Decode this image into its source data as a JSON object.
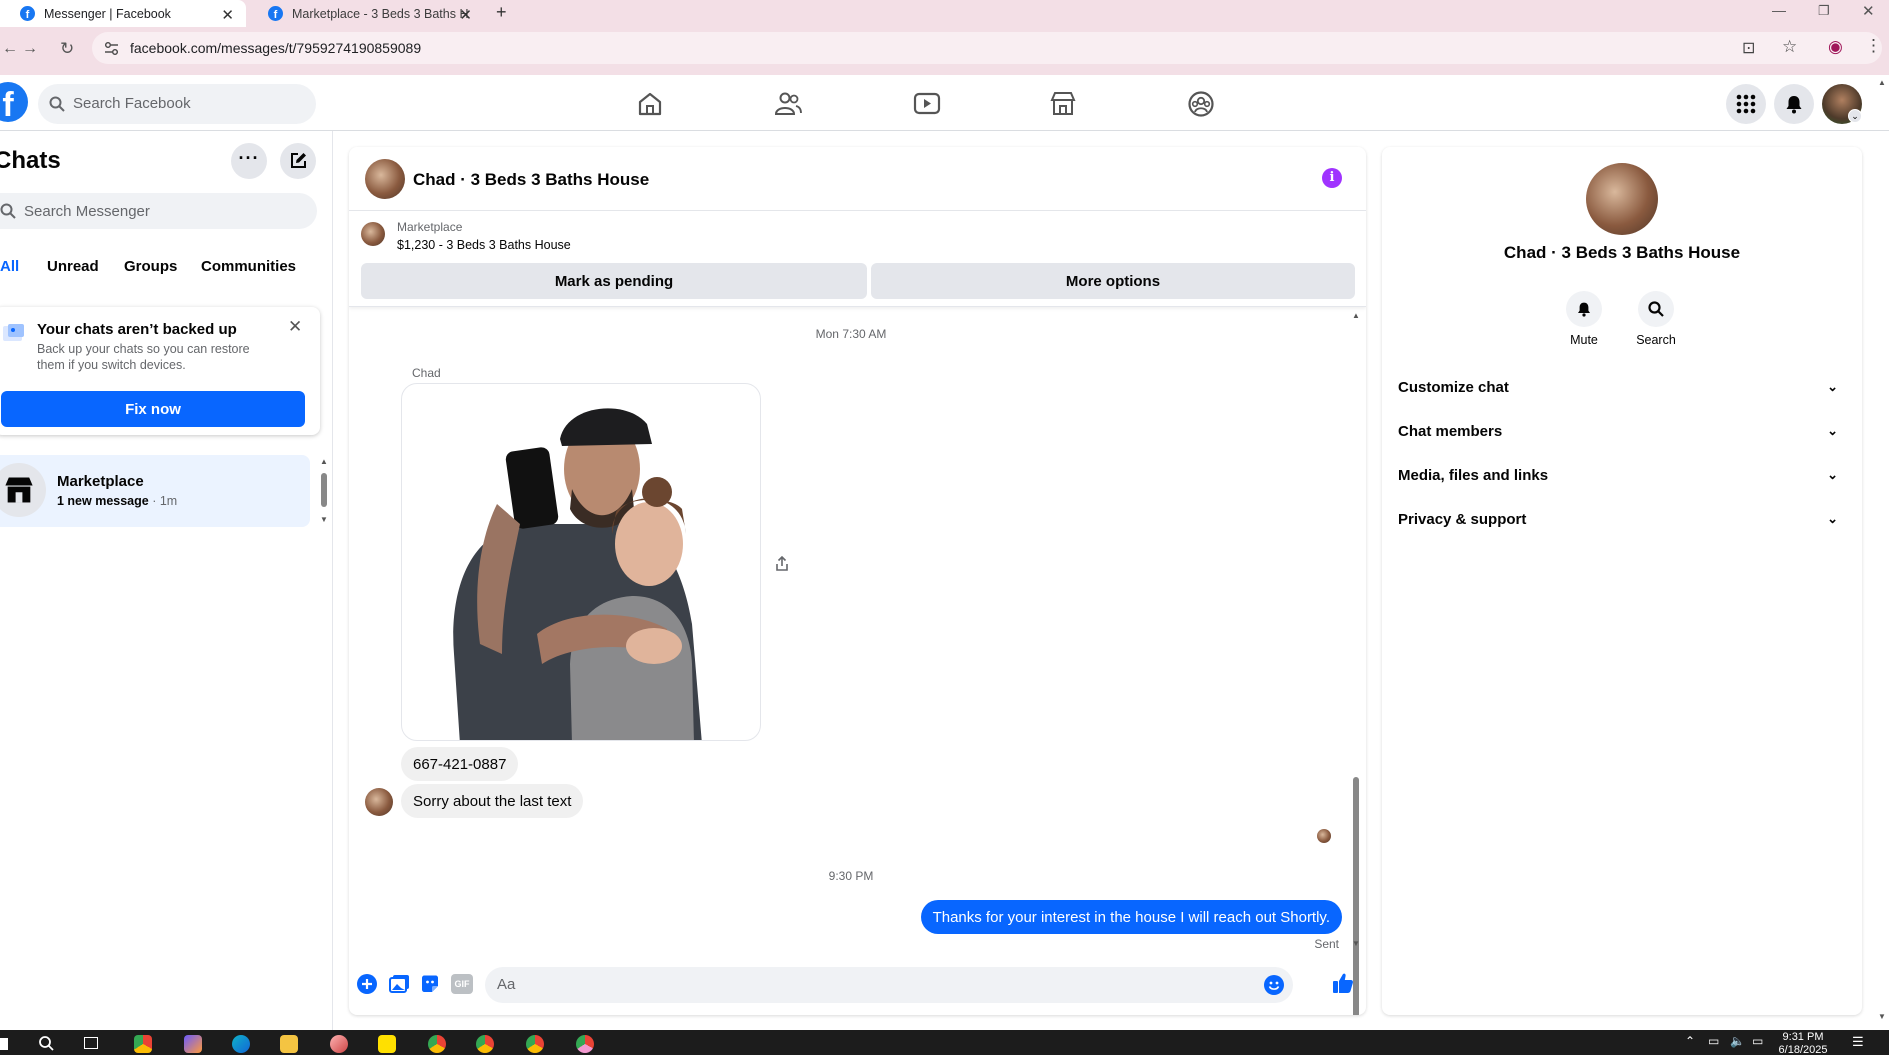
{
  "browser": {
    "tabs": [
      {
        "title": "Messenger | Facebook"
      },
      {
        "title": "Marketplace - 3 Beds 3 Baths H"
      }
    ],
    "new_tab": "+",
    "url": "facebook.com/messages/t/7959274190859089"
  },
  "fb": {
    "logo": "f",
    "search_placeholder": "Search Facebook",
    "nav_icons": [
      "home-icon",
      "friends-icon",
      "video-icon",
      "marketplace-icon",
      "groups-icon"
    ]
  },
  "sidebar": {
    "title": "Chats",
    "search_placeholder": "Search Messenger",
    "filters": [
      "All",
      "Unread",
      "Groups",
      "Communities"
    ],
    "backup": {
      "title": "Your chats aren’t backed up",
      "body_line1": "Back up your chats so you can restore",
      "body_line2": "them if you switch devices.",
      "button": "Fix now"
    },
    "conversation": {
      "name": "Marketplace",
      "preview": "1 new message",
      "time": " · 1m"
    }
  },
  "chat": {
    "title": "Chad · 3 Beds 3 Baths House",
    "listing": {
      "label": "Marketplace",
      "details": "$1,230 - 3 Beds 3 Baths House",
      "pending_button": "Mark as pending",
      "options_button": "More options"
    },
    "timestamp1": "Mon 7:30 AM",
    "sender": "Chad",
    "messages_in": [
      "667-421-0887",
      "Sorry about the last text"
    ],
    "timestamp2": "9:30 PM",
    "message_out": "Thanks for your interest in the house I will reach out Shortly.",
    "status": "Sent",
    "composer_placeholder": "Aa",
    "gif_label": "GIF"
  },
  "info_panel": {
    "name": "Chad · 3 Beds 3 Baths House",
    "mute_label": "Mute",
    "search_label": "Search",
    "sections": [
      "Customize chat",
      "Chat members",
      "Media, files and links",
      "Privacy & support"
    ]
  },
  "taskbar": {
    "time": "9:31 PM",
    "date": "6/18/2025"
  },
  "colors": {
    "accent": "#0866ff",
    "chrome": "#f3dfe6",
    "info_purple": "#a033ff"
  }
}
